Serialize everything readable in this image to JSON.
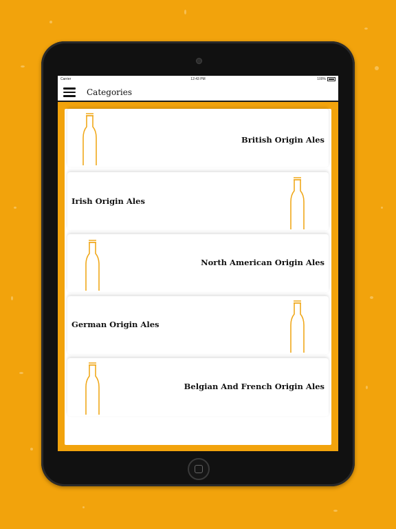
{
  "status_bar": {
    "carrier": "Carrier",
    "time": "12:43 PM",
    "battery": "100%"
  },
  "nav": {
    "title": "Categories",
    "menu_icon": "hamburger-menu-icon"
  },
  "categories": [
    {
      "label": "British Origin Ales",
      "icon": "beer-bottle-icon"
    },
    {
      "label": "Irish Origin Ales",
      "icon": "beer-bottle-icon"
    },
    {
      "label": "North American Origin Ales",
      "icon": "beer-bottle-icon"
    },
    {
      "label": "German Origin Ales",
      "icon": "beer-bottle-icon"
    },
    {
      "label": "Belgian And French Origin Ales",
      "icon": "beer-bottle-icon"
    }
  ],
  "colors": {
    "background": "#F2A30C",
    "bottle_outline": "#F0A81A",
    "text": "#111111"
  }
}
